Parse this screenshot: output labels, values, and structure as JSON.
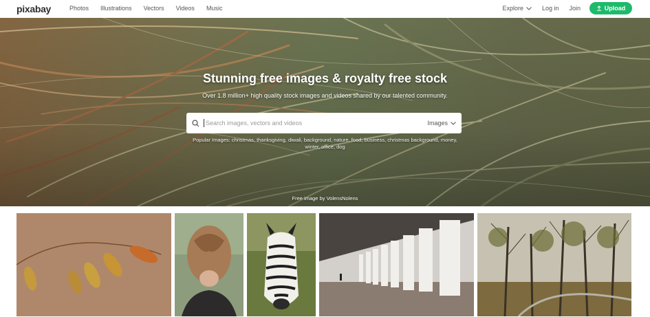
{
  "header": {
    "logo": "pixabay",
    "nav": [
      "Photos",
      "Illustrations",
      "Vectors",
      "Videos",
      "Music"
    ],
    "explore_label": "Explore",
    "login_label": "Log in",
    "join_label": "Join",
    "upload_label": "Upload",
    "upload_color": "#1dba6b"
  },
  "hero": {
    "title": "Stunning free images & royalty free stock",
    "subtitle": "Over 1.8 million+ high quality stock images and videos shared by our talented community.",
    "search": {
      "placeholder": "Search images, vectors and videos",
      "value": "",
      "type_label": "Images"
    },
    "popular_label": "Popular Images:",
    "popular_tags": [
      "christmas",
      "thanksgiving",
      "diwali",
      "background",
      "nature",
      "food",
      "business",
      "christmas background",
      "money",
      "winter",
      "office",
      "dog"
    ],
    "credit": "Free image by VolensNolens"
  },
  "gallery": {
    "tiles": [
      "grass-seed-photo",
      "braided-hair-photo",
      "zebra-photo",
      "colonnade-photo",
      "autumn-forest-photo"
    ]
  },
  "icons": {
    "search": "search-icon",
    "explore": "chevron-down-icon",
    "upload": "upload-icon",
    "type": "chevron-down-icon"
  }
}
